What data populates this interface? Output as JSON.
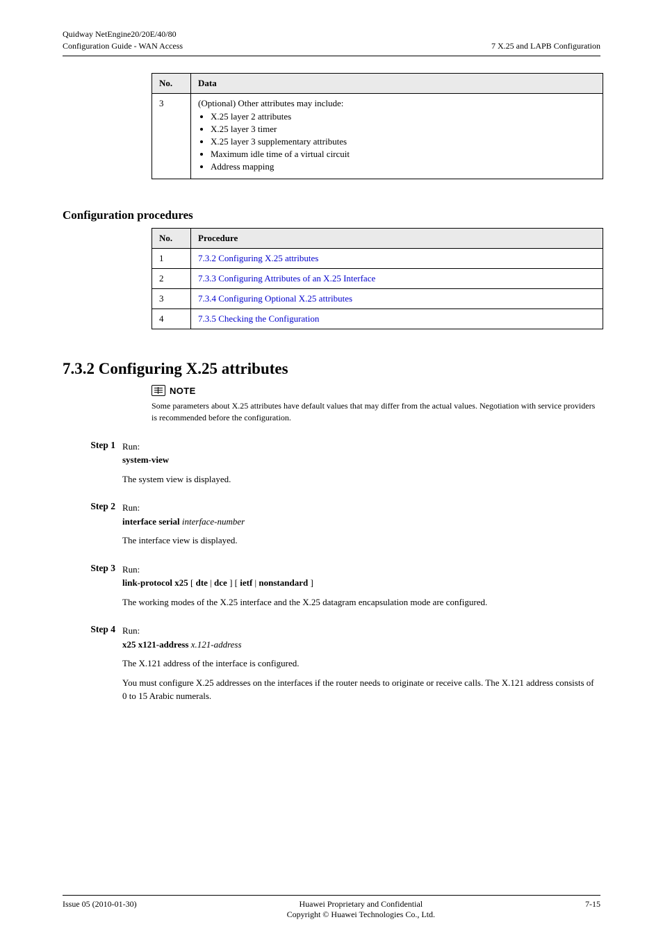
{
  "header": {
    "left_line1": "Quidway NetEngine20/20E/40/80",
    "left_line2": "Configuration Guide - WAN Access",
    "right_line1": "",
    "right_line2": "7 X.25 and LAPB Configuration"
  },
  "data_table": {
    "col_no": "No.",
    "col_data": "Data",
    "row_no": "3",
    "row_intro": "(Optional) Other attributes may include:",
    "bullets": [
      "X.25 layer 2 attributes",
      "X.25 layer 3 timer",
      "X.25 layer 3 supplementary attributes",
      "Maximum idle time of a virtual circuit",
      "Address mapping"
    ]
  },
  "config_heading": "Configuration procedures",
  "proc_table": {
    "col_no": "No.",
    "col_proc": "Procedure",
    "rows": [
      {
        "no": "1",
        "text": "7.3.2 Configuring X.25 attributes"
      },
      {
        "no": "2",
        "text": "7.3.3 Configuring Attributes of an X.25 Interface"
      },
      {
        "no": "3",
        "text": "7.3.4 Configuring Optional X.25 attributes"
      },
      {
        "no": "4",
        "text": "7.3.5 Checking the Configuration"
      }
    ]
  },
  "section": {
    "title": "7.3.2 Configuring X.25 attributes",
    "note_label": "NOTE",
    "note_text": "Some parameters about X.25 attributes have default values that may differ from the actual values. Negotiation with service providers is recommended before the configuration."
  },
  "steps": [
    {
      "label": "Step 1",
      "lines": [
        "Run:",
        "<b>system-view</b>",
        "The system view is displayed."
      ]
    },
    {
      "label": "Step 2",
      "lines": [
        "Run:",
        "<b>interface serial</b> <i>interface-number</i>",
        "The interface view is displayed."
      ]
    },
    {
      "label": "Step 3",
      "lines": [
        "Run:",
        "<b>link-protocol x25</b> [ <b>dte</b> | <b>dce</b> ] [ <b>ietf</b> | <b>nonstandard</b> ]",
        "The working modes of the X.25 interface and the X.25 datagram encapsulation mode are configured."
      ]
    },
    {
      "label": "Step 4",
      "lines": [
        "Run:",
        "<b>x25 x121-address</b> <i>x.121-address</i>",
        "The X.121 address of the interface is configured.",
        "You must configure X.25 addresses on the interfaces if the router needs to originate or receive calls. The X.121 address consists of 0 to 15 Arabic numerals."
      ]
    }
  ],
  "footer": {
    "left_line1": "Issue 05 (2010-01-30)",
    "center_line1": "Huawei Proprietary and Confidential",
    "center_line2": "Copyright © Huawei Technologies Co., Ltd.",
    "right_line1": "7-15"
  }
}
